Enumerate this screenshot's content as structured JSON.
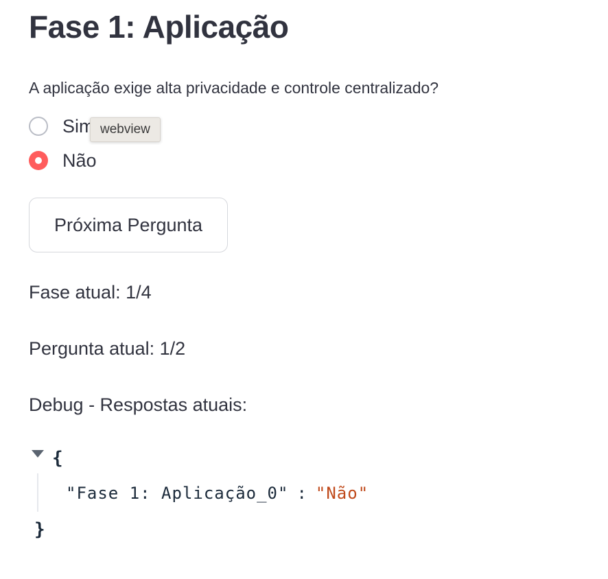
{
  "page": {
    "title": "Fase 1: Aplicação"
  },
  "question": {
    "label": "A aplicação exige alta privacidade e controle centralizado?",
    "options": [
      {
        "label": "Sim",
        "selected": false
      },
      {
        "label": "Não",
        "selected": true
      }
    ]
  },
  "tooltip": {
    "text": "webview"
  },
  "actions": {
    "next_label": "Próxima Pergunta"
  },
  "status": {
    "phase": "Fase atual: 1/4",
    "question": "Pergunta atual: 1/2",
    "debug_label": "Debug - Respostas atuais:"
  },
  "json_view": {
    "open_brace": "{",
    "close_brace": "}",
    "entries": [
      {
        "key": "\"Fase 1: Aplicação_0\"",
        "colon": ":",
        "value": "\"Não\""
      }
    ]
  },
  "colors": {
    "accent": "#ff4b4b",
    "text": "#31333f",
    "json_string": "#c04a1b"
  },
  "icons": {
    "radio_unchecked": "radio-unchecked-icon",
    "radio_checked": "radio-checked-icon",
    "expand": "caret-down-icon"
  }
}
